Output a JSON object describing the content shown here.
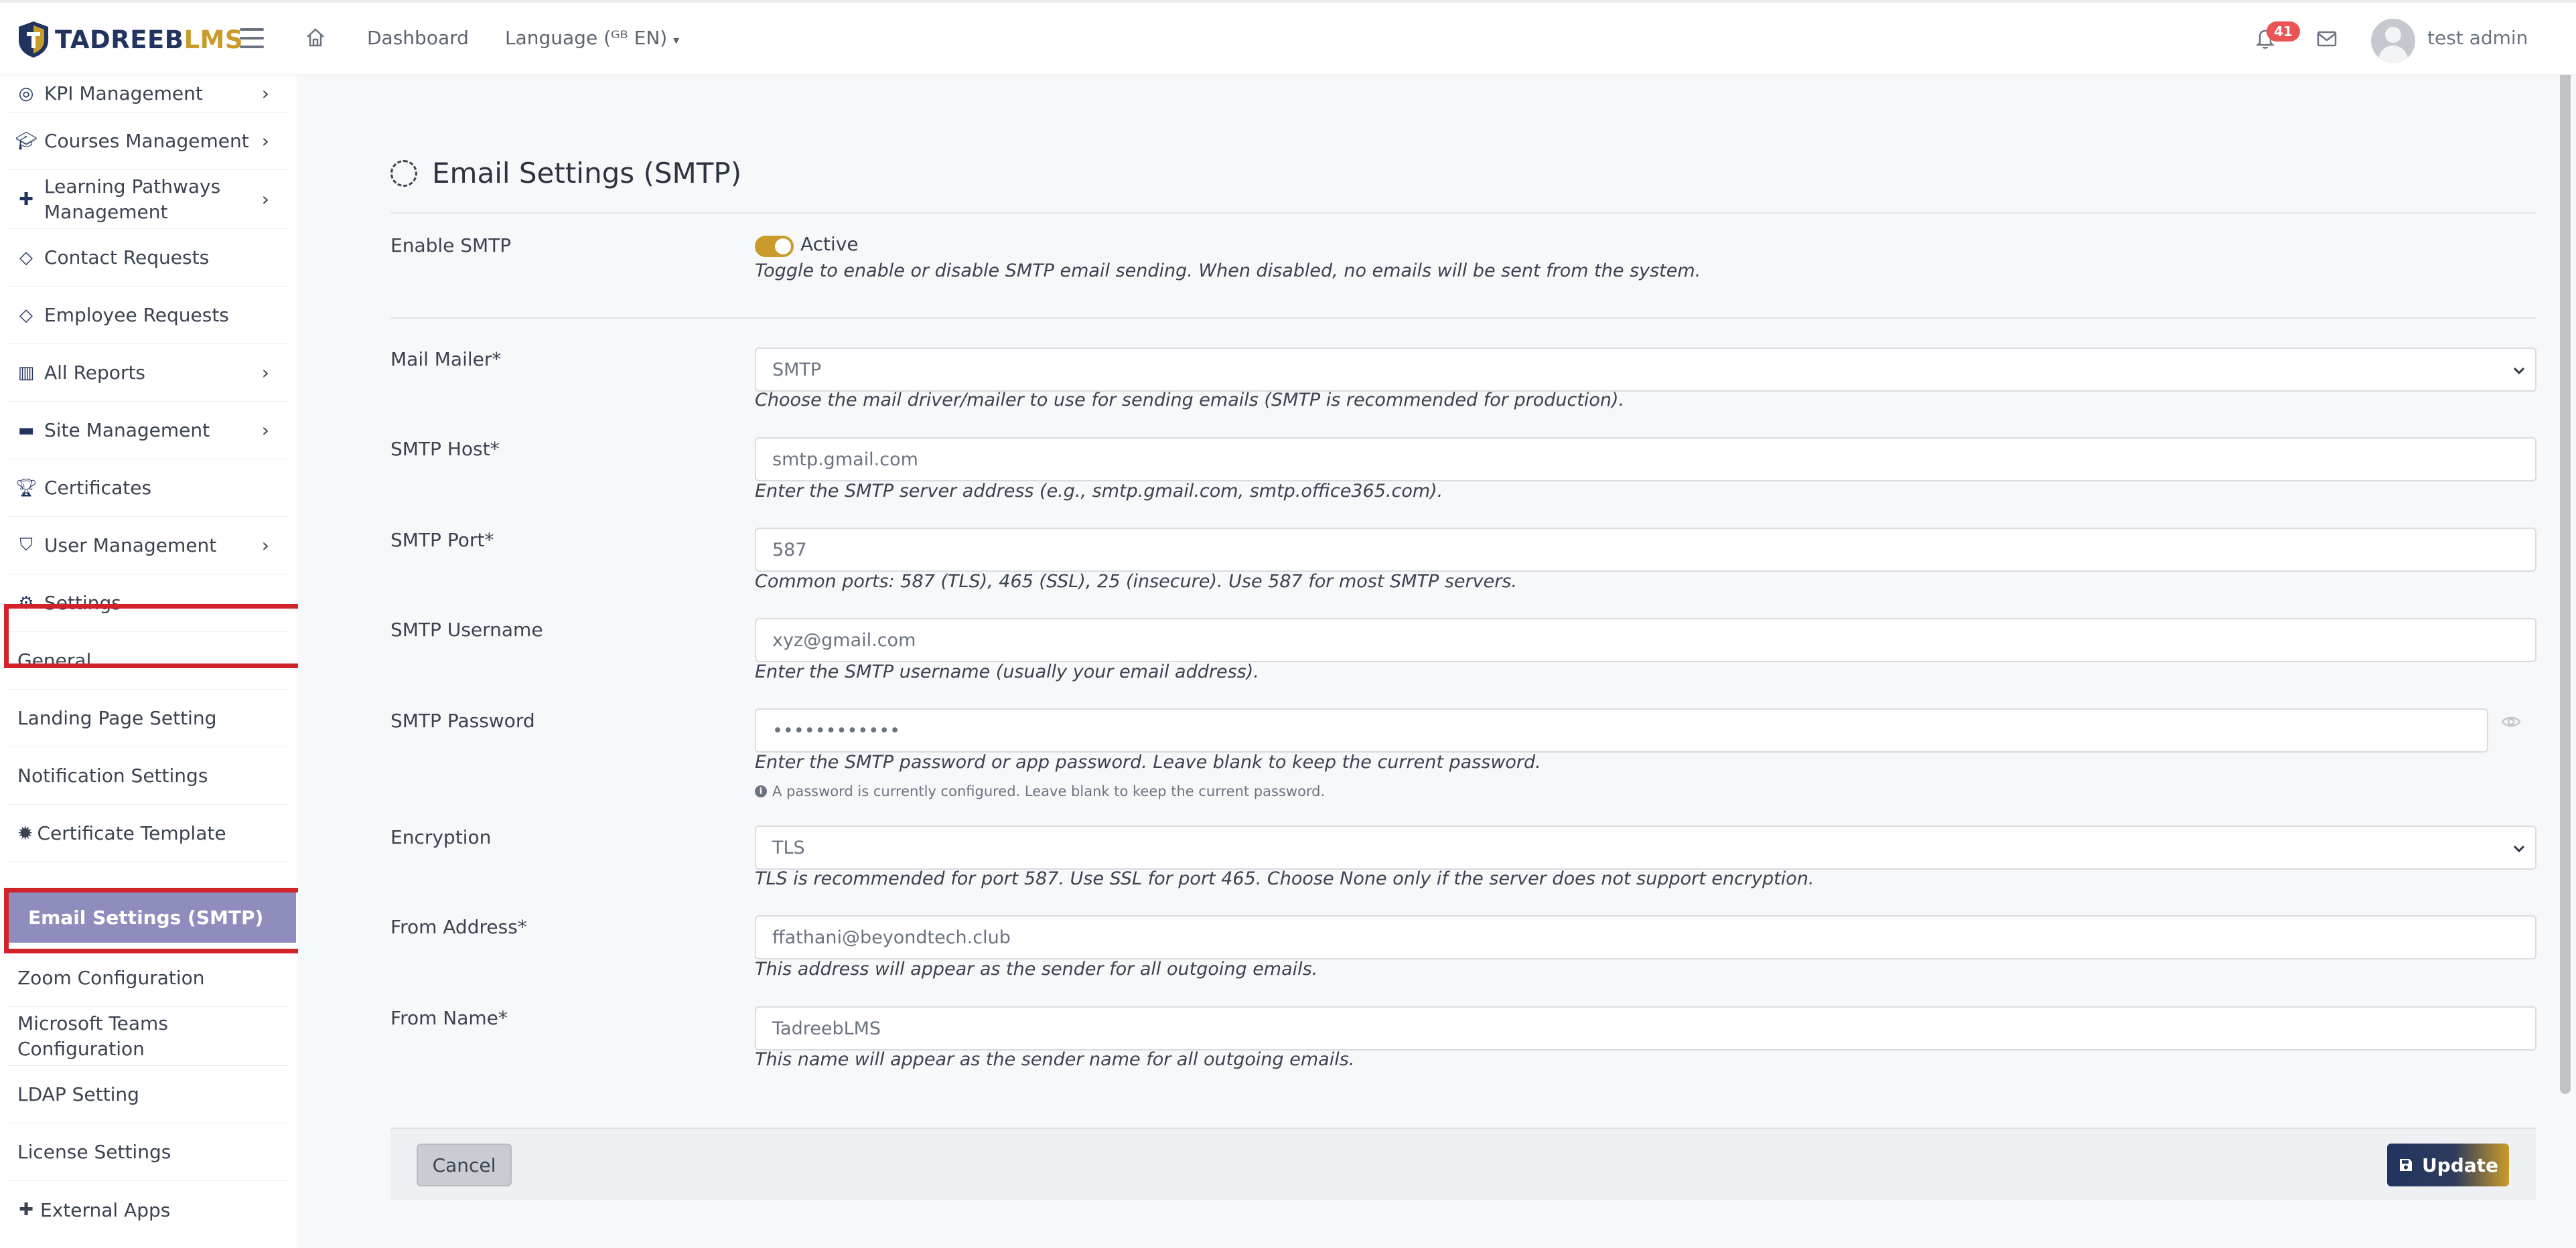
{
  "app": {
    "logo_part1": "TADREEB",
    "logo_part2": "LMS"
  },
  "topbar": {
    "dashboard": "Dashboard",
    "language": "Language (ᴳᴮ EN)",
    "notification_count": "41",
    "user_name": "test admin"
  },
  "sidebar": {
    "items": [
      {
        "label": "KPI Management",
        "icon": "target-icon",
        "chevron": ">"
      },
      {
        "label": "Courses Management",
        "icon": "graduation-cap-icon",
        "chevron": ">"
      },
      {
        "label": "Learning Pathways",
        "label2": "Management",
        "icon": "puzzle-icon",
        "chevron": ">"
      },
      {
        "label": "Contact Requests",
        "icon": "tag-icon"
      },
      {
        "label": "Employee Requests",
        "icon": "tag-icon"
      },
      {
        "label": "All Reports",
        "icon": "bar-chart-icon",
        "chevron": ">"
      },
      {
        "label": "Site Management",
        "icon": "folder-icon",
        "chevron": ">"
      },
      {
        "label": "Certificates",
        "icon": "trophy-icon"
      },
      {
        "label": "User Management",
        "icon": "shield-icon",
        "chevron": ">"
      },
      {
        "label": "Settings",
        "icon": "gear-icon",
        "chevron": "v"
      }
    ],
    "sub_items": [
      {
        "label": "General"
      },
      {
        "label": "Landing Page Setting"
      },
      {
        "label": "Notification Settings"
      },
      {
        "label": "Certificate Template"
      },
      {
        "label": "Email Settings (SMTP)"
      },
      {
        "label": "Zoom Configuration"
      },
      {
        "label": "Microsoft Teams",
        "label2": "Configuration"
      },
      {
        "label": "LDAP Setting"
      },
      {
        "label": "License Settings"
      },
      {
        "label": "External Apps"
      }
    ]
  },
  "page": {
    "title": "Email Settings (SMTP)"
  },
  "form": {
    "enable_smtp": {
      "label": "Enable SMTP",
      "state": "Active",
      "help": "Toggle to enable or disable SMTP email sending. When disabled, no emails will be sent from the system."
    },
    "mail_mailer": {
      "label": "Mail Mailer*",
      "value": "SMTP",
      "help": "Choose the mail driver/mailer to use for sending emails (SMTP is recommended for production)."
    },
    "smtp_host": {
      "label": "SMTP Host*",
      "value": "smtp.gmail.com",
      "help": "Enter the SMTP server address (e.g., smtp.gmail.com, smtp.office365.com)."
    },
    "smtp_port": {
      "label": "SMTP Port*",
      "value": "587",
      "help": "Common ports: 587 (TLS), 465 (SSL), 25 (insecure). Use 587 for most SMTP servers."
    },
    "smtp_username": {
      "label": "SMTP Username",
      "value": "xyz@gmail.com",
      "help": "Enter the SMTP username (usually your email address)."
    },
    "smtp_password": {
      "label": "SMTP Password",
      "value": "••••••••••••",
      "help": "Enter the SMTP password or app password. Leave blank to keep the current password.",
      "note": "A password is currently configured. Leave blank to keep the current password."
    },
    "encryption": {
      "label": "Encryption",
      "value": "TLS",
      "help": "TLS is recommended for port 587. Use SSL for port 465. Choose None only if the server does not support encryption."
    },
    "from_address": {
      "label": "From Address*",
      "value": "ffathani@beyondtech.club",
      "help": "This address will appear as the sender for all outgoing emails."
    },
    "from_name": {
      "label": "From Name*",
      "value": "TadreebLMS",
      "help": "This name will appear as the sender name for all outgoing emails."
    }
  },
  "actions": {
    "cancel": "Cancel",
    "update": "Update"
  },
  "colors": {
    "brand_navy": "#21345f",
    "brand_gold": "#c99b2a",
    "active_item": "#8f8dbd",
    "highlight_outline": "#d3232a",
    "badge": "#ea5455"
  }
}
